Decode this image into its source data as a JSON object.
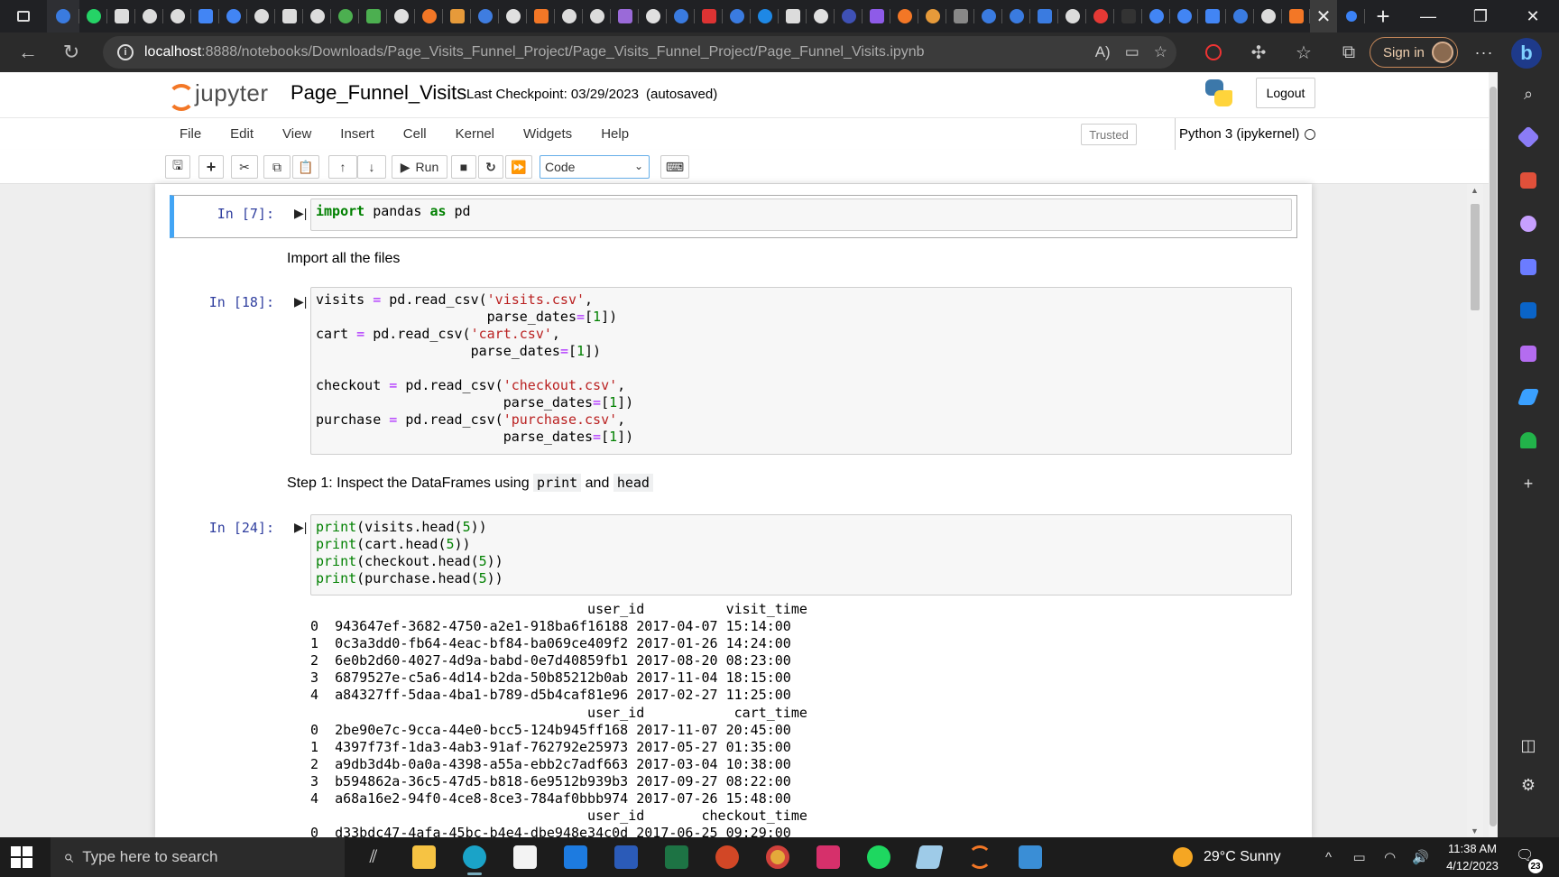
{
  "browser": {
    "url_host": "localhost",
    "url_path": ":8888/notebooks/Downloads/Page_Visits_Funnel_Project/Page_Visits_Funnel_Project/Page_Funnel_Visits.ipynb",
    "signin_label": "Sign in",
    "tab_close": "✕",
    "new_tab": "+",
    "more": "···",
    "copilot": "b"
  },
  "jupyter": {
    "logo_text": "jupyter",
    "notebook_name": "Page_Funnel_Visits",
    "checkpoint": "Last Checkpoint: 03/29/2023",
    "autosaved": "(autosaved)",
    "logout_label": "Logout",
    "menu": [
      "File",
      "Edit",
      "View",
      "Insert",
      "Cell",
      "Kernel",
      "Widgets",
      "Help"
    ],
    "trusted_label": "Trusted",
    "kernel_label": "Python 3 (ipykernel)",
    "run_label": "Run",
    "cell_type": "Code"
  },
  "cells": {
    "c1": {
      "prompt": "In [7]:"
    },
    "md1": {
      "text": "Import all the files"
    },
    "c2": {
      "prompt": "In [18]:"
    },
    "md2": {
      "text_before": "Step 1: Inspect the DataFrames using",
      "code1": "print",
      "text_mid": "and",
      "code2": "head"
    },
    "c3": {
      "prompt": "In [24]:"
    }
  },
  "output": {
    "visits": {
      "header": "                                  user_id          visit_time",
      "rows": [
        "0  943647ef-3682-4750-a2e1-918ba6f16188 2017-04-07 15:14:00",
        "1  0c3a3dd0-fb64-4eac-bf84-ba069ce409f2 2017-01-26 14:24:00",
        "2  6e0b2d60-4027-4d9a-babd-0e7d40859fb1 2017-08-20 08:23:00",
        "3  6879527e-c5a6-4d14-b2da-50b85212b0ab 2017-11-04 18:15:00",
        "4  a84327ff-5daa-4ba1-b789-d5b4caf81e96 2017-02-27 11:25:00"
      ]
    },
    "cart": {
      "header": "                                  user_id           cart_time",
      "rows": [
        "0  2be90e7c-9cca-44e0-bcc5-124b945ff168 2017-11-07 20:45:00",
        "1  4397f73f-1da3-4ab3-91af-762792e25973 2017-05-27 01:35:00",
        "2  a9db3d4b-0a0a-4398-a55a-ebb2c7adf663 2017-03-04 10:38:00",
        "3  b594862a-36c5-47d5-b818-6e9512b939b3 2017-09-27 08:22:00",
        "4  a68a16e2-94f0-4ce8-8ce3-784af0bbb974 2017-07-26 15:48:00"
      ]
    },
    "checkout": {
      "header": "                                  user_id       checkout_time",
      "partial_row": "0  d33bdc47-4afa-45bc-b4e4-dbe948e34c0d 2017-06-25 09:29:00"
    }
  },
  "sidebar_icons": [
    "search-icon",
    "tag-icon",
    "toolbox-icon",
    "games-icon",
    "copilot-icon",
    "outlook-icon",
    "designer-icon",
    "send-icon",
    "tree-icon",
    "add-icon",
    "split-screen-icon",
    "settings-icon"
  ],
  "taskbar": {
    "search_placeholder": "Type here to search",
    "weather": "29°C  Sunny",
    "time": "11:38 AM",
    "date": "4/12/2023",
    "notifications": "23"
  },
  "colors": {
    "jupyter_orange": "#f37726",
    "selected_cell": "#42a5f5",
    "prompt_blue": "#303f9f"
  }
}
